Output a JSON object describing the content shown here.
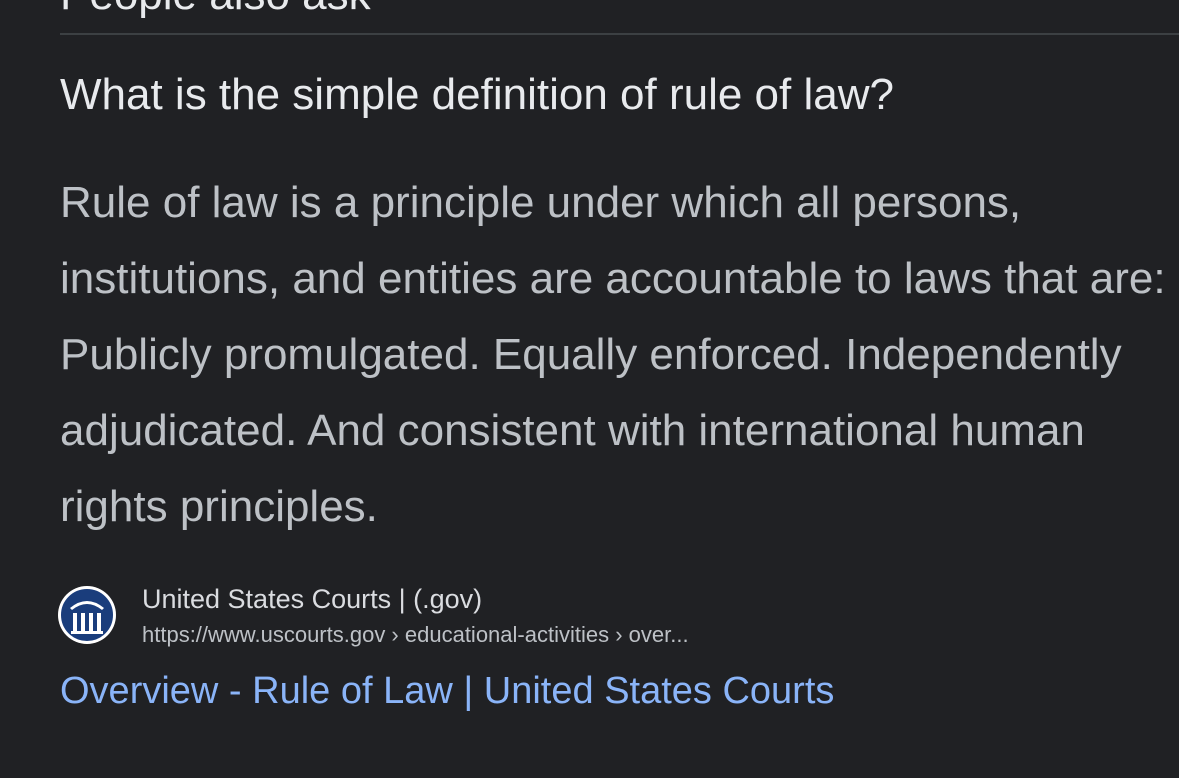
{
  "section": {
    "header": "People also ask"
  },
  "question": {
    "text": "What is the simple definition of rule of law?"
  },
  "answer": {
    "text": "Rule of law is a principle under which all persons, institutions, and entities are accountable to laws that are: Publicly promulgated. Equally enforced. Independently adjudicated. And consistent with international human rights principles."
  },
  "source": {
    "site_name": "United States Courts | (.gov)",
    "url": "https://www.uscourts.gov › educational-activities › over...",
    "favicon": "us-courts-logo-icon"
  },
  "result": {
    "title": "Overview - Rule of Law | United States Courts"
  },
  "colors": {
    "background": "#202124",
    "link": "#8ab4f8",
    "primary_text": "#e8eaed",
    "secondary_text": "#bdc1c6"
  }
}
